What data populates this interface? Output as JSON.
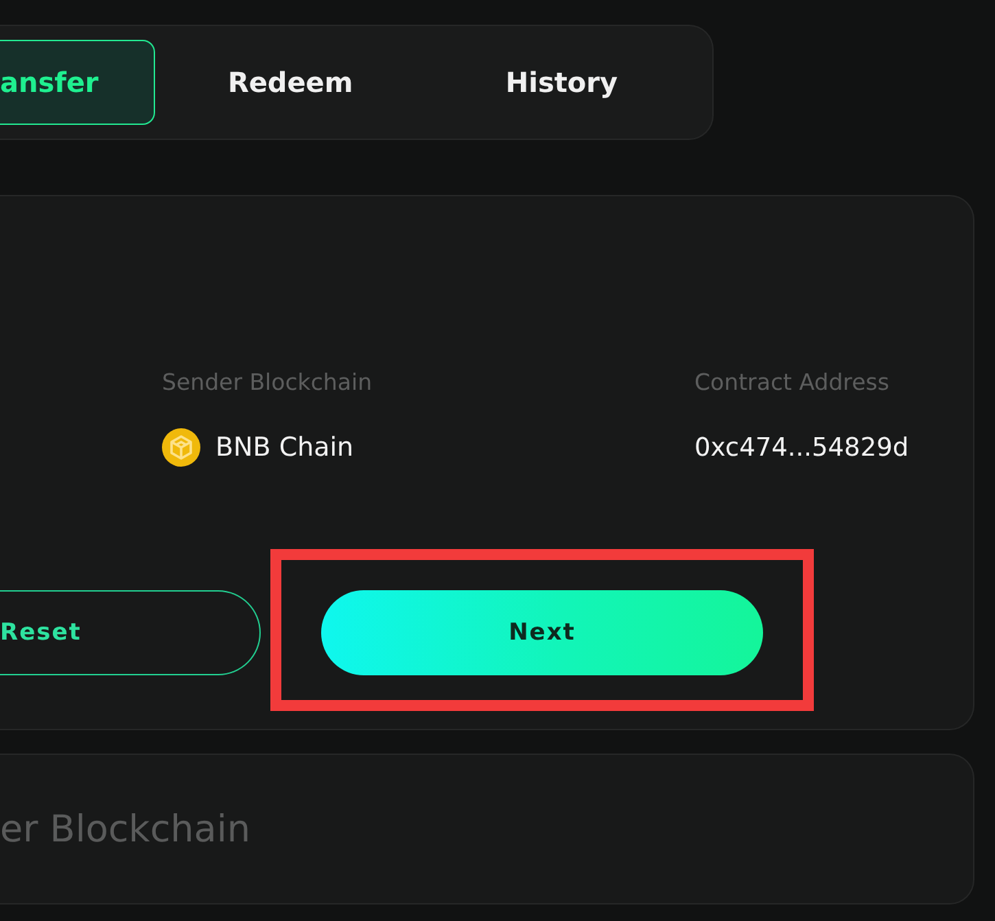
{
  "tabs": [
    {
      "label": "ansfer",
      "selected": true
    },
    {
      "label": "Redeem",
      "selected": false
    },
    {
      "label": "History",
      "selected": false
    }
  ],
  "details": {
    "fields": [
      {
        "label": "Sender Blockchain",
        "value": "BNB Chain",
        "kind": "chain"
      },
      {
        "label": "Contract Address",
        "value": "0xc474...54829d",
        "kind": "text"
      }
    ]
  },
  "buttons": [
    {
      "label": "Reset",
      "kind": "outline",
      "highlighted": false
    },
    {
      "label": "Next",
      "kind": "primary",
      "highlighted": true
    }
  ],
  "next_section": {
    "title": "er Blockchain"
  }
}
